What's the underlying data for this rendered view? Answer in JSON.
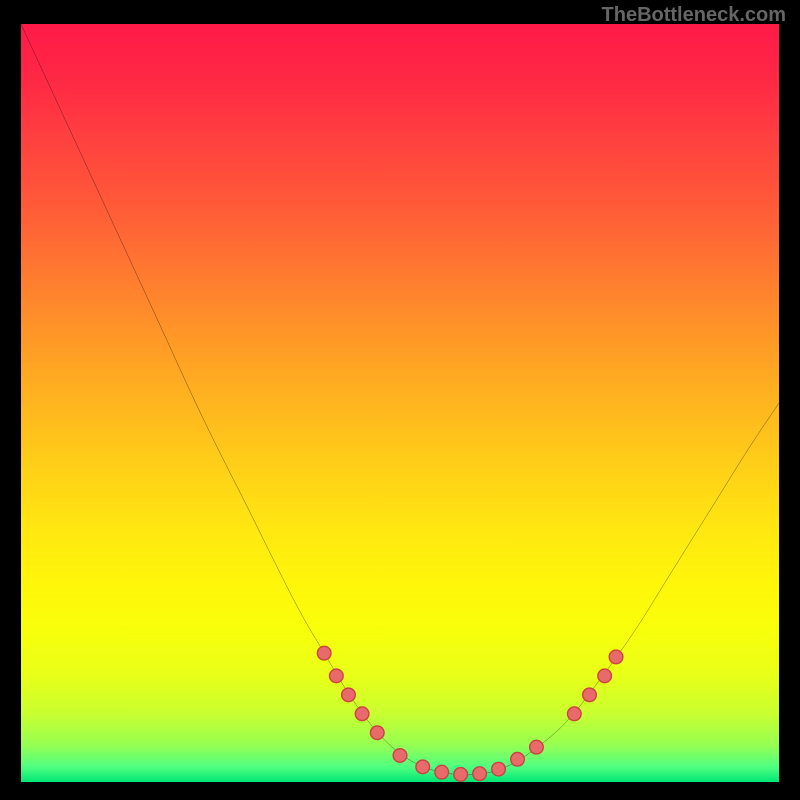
{
  "watermark": "TheBottleneck.com",
  "chart_data": {
    "type": "line",
    "title": "",
    "xlabel": "",
    "ylabel": "",
    "xlim": [
      0,
      100
    ],
    "ylim": [
      0,
      100
    ],
    "note": "V-shaped bottleneck curve over red→green vertical gradient. No axis ticks or numeric labels are visible in the image; data points below are pixel estimates (0–100) of the black curve path and red marker dots.",
    "curve": [
      {
        "x": 0.0,
        "y": 100.0
      },
      {
        "x": 6.0,
        "y": 87.0
      },
      {
        "x": 12.0,
        "y": 74.0
      },
      {
        "x": 18.0,
        "y": 61.0
      },
      {
        "x": 24.0,
        "y": 48.0
      },
      {
        "x": 30.0,
        "y": 36.0
      },
      {
        "x": 36.0,
        "y": 24.0
      },
      {
        "x": 40.0,
        "y": 17.0
      },
      {
        "x": 44.0,
        "y": 10.5
      },
      {
        "x": 48.0,
        "y": 5.5
      },
      {
        "x": 52.0,
        "y": 2.5
      },
      {
        "x": 56.0,
        "y": 1.2
      },
      {
        "x": 60.0,
        "y": 1.0
      },
      {
        "x": 64.0,
        "y": 2.0
      },
      {
        "x": 68.0,
        "y": 4.5
      },
      {
        "x": 72.0,
        "y": 8.0
      },
      {
        "x": 76.0,
        "y": 13.0
      },
      {
        "x": 81.0,
        "y": 20.0
      },
      {
        "x": 86.0,
        "y": 28.0
      },
      {
        "x": 91.0,
        "y": 36.0
      },
      {
        "x": 96.0,
        "y": 44.0
      },
      {
        "x": 100.0,
        "y": 50.0
      }
    ],
    "markers": [
      {
        "x": 40.0,
        "y": 17.0
      },
      {
        "x": 41.6,
        "y": 14.0
      },
      {
        "x": 43.2,
        "y": 11.5
      },
      {
        "x": 45.0,
        "y": 9.0
      },
      {
        "x": 47.0,
        "y": 6.5
      },
      {
        "x": 50.0,
        "y": 3.5
      },
      {
        "x": 53.0,
        "y": 2.0
      },
      {
        "x": 55.5,
        "y": 1.3
      },
      {
        "x": 58.0,
        "y": 1.0
      },
      {
        "x": 60.5,
        "y": 1.1
      },
      {
        "x": 63.0,
        "y": 1.7
      },
      {
        "x": 65.5,
        "y": 3.0
      },
      {
        "x": 68.0,
        "y": 4.6
      },
      {
        "x": 73.0,
        "y": 9.0
      },
      {
        "x": 75.0,
        "y": 11.5
      },
      {
        "x": 77.0,
        "y": 14.0
      },
      {
        "x": 78.5,
        "y": 16.5
      }
    ],
    "colors": {
      "curve": "#000000",
      "marker_fill": "#e86a6a",
      "marker_stroke": "#cc4040",
      "gradient_top": "#ff1a48",
      "gradient_bottom": "#00e676",
      "background": "#000000"
    }
  }
}
